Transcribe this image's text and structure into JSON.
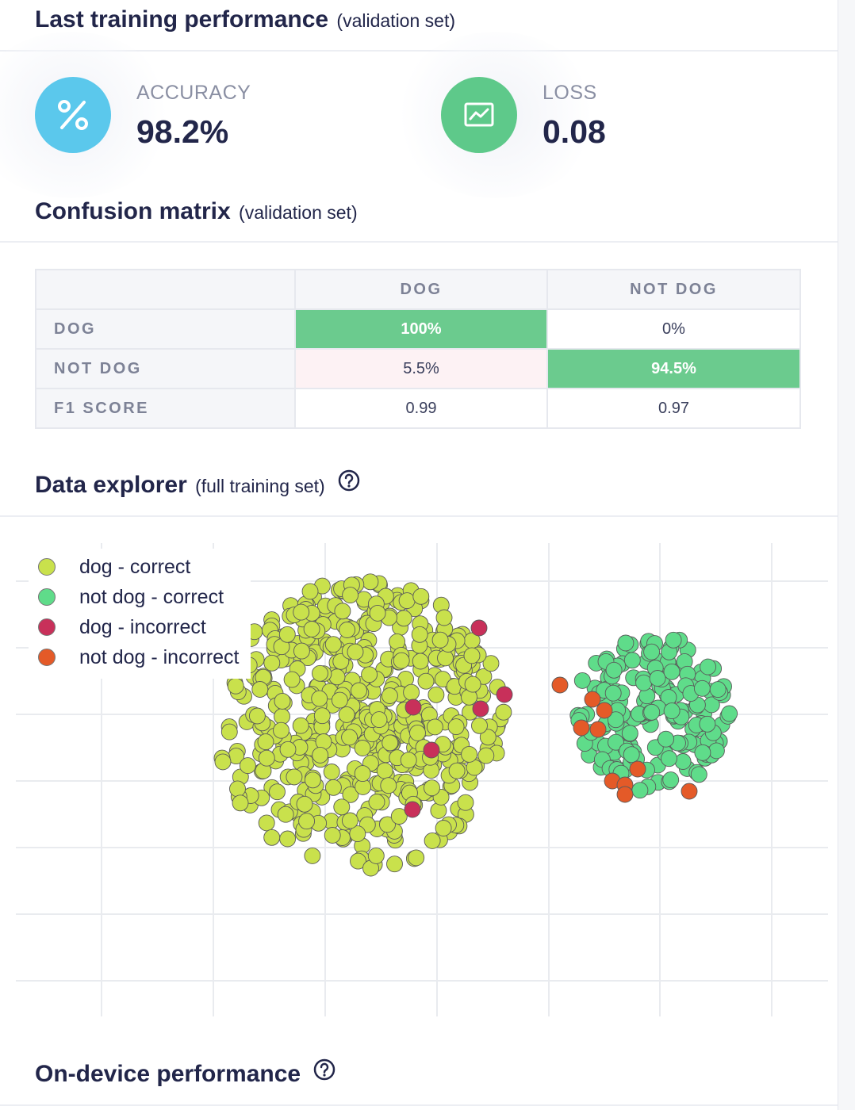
{
  "sections": {
    "training": {
      "title": "Last training performance",
      "subtitle": "(validation set)"
    },
    "confusion": {
      "title": "Confusion matrix",
      "subtitle": "(validation set)"
    },
    "explorer": {
      "title": "Data explorer",
      "subtitle": "(full training set)"
    },
    "ondevice": {
      "title": "On-device performance"
    }
  },
  "metrics": {
    "accuracy": {
      "label": "ACCURACY",
      "value": "98.2%",
      "icon": "percent-icon",
      "color": "#5bc8ec"
    },
    "loss": {
      "label": "LOSS",
      "value": "0.08",
      "icon": "trend-chart-icon",
      "color": "#5ec98a"
    }
  },
  "confusion_matrix": {
    "columns": [
      "DOG",
      "NOT DOG"
    ],
    "rows": [
      {
        "label": "DOG",
        "values": [
          "100%",
          "0%"
        ]
      },
      {
        "label": "NOT DOG",
        "values": [
          "5.5%",
          "94.5%"
        ]
      },
      {
        "label": "F1 SCORE",
        "values": [
          "0.99",
          "0.97"
        ]
      }
    ]
  },
  "legend": [
    {
      "label": "dog - correct",
      "color": "#c9e14c"
    },
    {
      "label": "not dog - correct",
      "color": "#5fdc8a"
    },
    {
      "label": "dog - incorrect",
      "color": "#c8305a"
    },
    {
      "label": "not dog - incorrect",
      "color": "#e45a28"
    }
  ],
  "chart_data": {
    "type": "scatter",
    "grid": true,
    "legend_position": "top-left",
    "series": [
      {
        "name": "dog - correct",
        "color": "#c9e14c",
        "cluster": {
          "cx": 455,
          "cy": 915,
          "r": 185,
          "count": 520
        }
      },
      {
        "name": "not dog - correct",
        "color": "#5fdc8a",
        "cluster": {
          "cx": 822,
          "cy": 900,
          "r": 100,
          "count": 170
        }
      },
      {
        "name": "dog - incorrect",
        "color": "#c8305a",
        "points": [
          [
            604,
            792
          ],
          [
            636,
            876
          ],
          [
            521,
            892
          ],
          [
            606,
            894
          ],
          [
            544,
            946
          ],
          [
            520,
            1021
          ]
        ]
      },
      {
        "name": "not dog - incorrect",
        "color": "#e45a28",
        "points": [
          [
            706,
            864
          ],
          [
            747,
            882
          ],
          [
            762,
            896
          ],
          [
            733,
            918
          ],
          [
            754,
            920
          ],
          [
            772,
            985
          ],
          [
            804,
            970
          ],
          [
            788,
            990
          ],
          [
            788,
            1002
          ],
          [
            869,
            998
          ]
        ]
      }
    ]
  }
}
